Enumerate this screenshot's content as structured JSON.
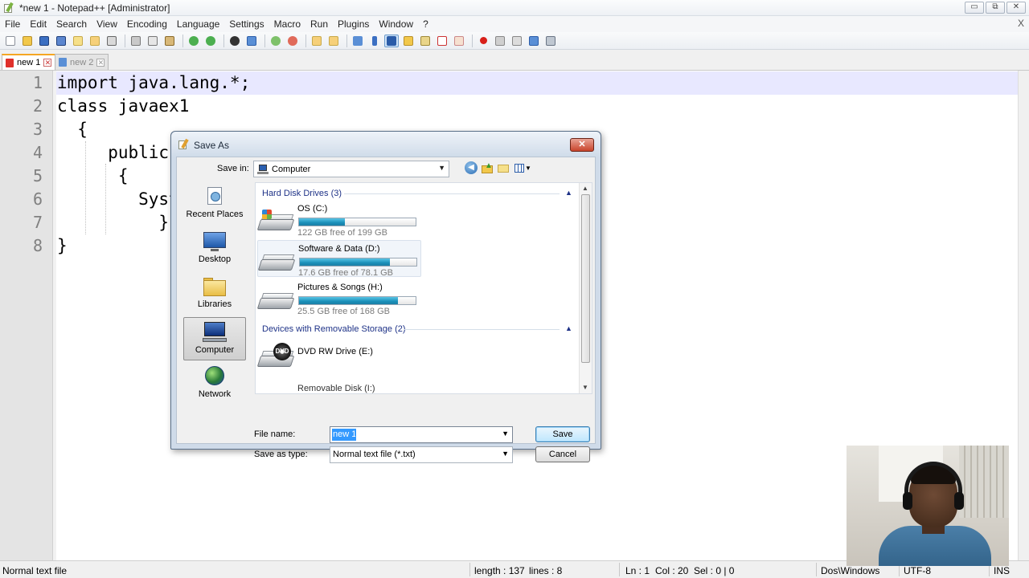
{
  "window": {
    "title": "*new 1 - Notepad++ [Administrator]",
    "controls": [
      "▭",
      "⧉",
      "✕"
    ]
  },
  "menu": {
    "items": [
      "File",
      "Edit",
      "Search",
      "View",
      "Encoding",
      "Language",
      "Settings",
      "Macro",
      "Run",
      "Plugins",
      "Window",
      "?"
    ],
    "close": "X"
  },
  "toolbar": {
    "icons": [
      "new-file-icon",
      "open-file-icon",
      "save-icon",
      "save-all-icon",
      "close-icon",
      "close-all-icon",
      "print-icon",
      "cut-icon",
      "copy-icon",
      "paste-icon",
      "undo-icon",
      "redo-icon",
      "find-icon",
      "replace-icon",
      "zoom-in-icon",
      "zoom-out-icon",
      "sync-vertical-icon",
      "sync-horizontal-icon",
      "word-wrap-icon",
      "show-all-chars-icon",
      "indent-guide-icon",
      "user-language-icon",
      "document-map-icon",
      "function-list-icon",
      "folder-as-workspace-icon",
      "record-macro-icon",
      "stop-macro-icon",
      "play-macro-icon",
      "run-macro-multiple-icon",
      "save-macro-icon"
    ]
  },
  "tabs": [
    {
      "label": "new 1",
      "active": true
    },
    {
      "label": "new 2",
      "active": false
    }
  ],
  "editor": {
    "lines": [
      {
        "num": "1",
        "text": "import java.lang.*;"
      },
      {
        "num": "2",
        "text": "class javaex1"
      },
      {
        "num": "3",
        "text": "  {"
      },
      {
        "num": "4",
        "text": "     public"
      },
      {
        "num": "5",
        "text": "      {"
      },
      {
        "num": "6",
        "text": "        Syst"
      },
      {
        "num": "7",
        "text": "          }"
      },
      {
        "num": "8",
        "text": "}"
      }
    ]
  },
  "dialog": {
    "title": "Save As",
    "close": "✕",
    "save_in_label": "Save in:",
    "save_in_value": "Computer",
    "places": [
      "Recent Places",
      "Desktop",
      "Libraries",
      "Computer",
      "Network"
    ],
    "active_place": "Computer",
    "groups": [
      {
        "header": "Hard Disk Drives (3)"
      },
      {
        "header": "Devices with Removable Storage (2)"
      }
    ],
    "drives": [
      {
        "name": "OS (C:)",
        "free": "122 GB free of 199 GB",
        "used_fraction": 0.39
      },
      {
        "name": "Software & Data (D:)",
        "free": "17.6 GB free of 78.1 GB",
        "used_fraction": 0.77
      },
      {
        "name": "Pictures & Songs (H:)",
        "free": "25.5 GB free of 168 GB",
        "used_fraction": 0.85
      }
    ],
    "removable": [
      {
        "name": "DVD RW Drive (E:)",
        "badge": "DVD"
      },
      {
        "name": "Removable Disk (I:)"
      }
    ],
    "filename_label": "File name:",
    "filename_value": "new 1",
    "savetype_label": "Save as type:",
    "savetype_value": "Normal text file (*.txt)",
    "save_button": "Save",
    "cancel_button": "Cancel"
  },
  "status": {
    "filetype": "Normal text file",
    "length": "length : 137",
    "lines": "lines : 8",
    "ln": "Ln : 1",
    "col": "Col : 20",
    "sel": "Sel : 0 | 0",
    "eol": "Dos\\Windows",
    "encoding": "UTF-8",
    "mode": "INS"
  },
  "colors": {
    "current_line": "#e8e8ff",
    "selection": "#3399ff",
    "drive_bar": "#1a8fb9"
  }
}
